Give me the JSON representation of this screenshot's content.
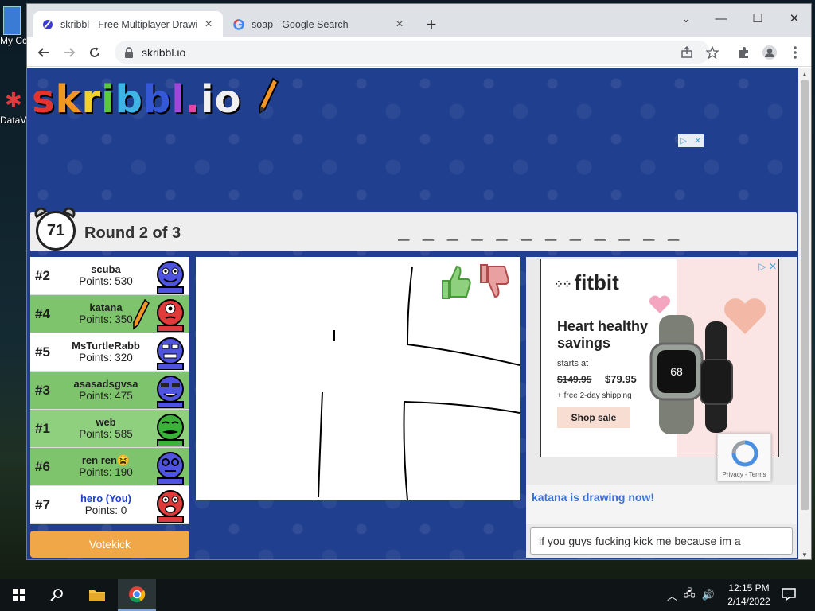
{
  "desktop": {
    "icons": [
      {
        "label": "My Co"
      },
      {
        "label": "DataV"
      }
    ]
  },
  "browser": {
    "tabs": [
      {
        "title": "skribbl - Free Multiplayer Drawin",
        "icon": "skribbl-favicon",
        "active": true
      },
      {
        "title": "soap - Google Search",
        "icon": "google-favicon",
        "active": false
      }
    ],
    "new_tab": "+",
    "window_controls": {
      "collapse": "⌄",
      "minimize": "—",
      "maximize": "☐",
      "close": "✕"
    },
    "url": "skribbl.io"
  },
  "game": {
    "logo_letters": [
      {
        "ch": "s",
        "color": "#e5342d"
      },
      {
        "ch": "k",
        "color": "#f29522"
      },
      {
        "ch": "r",
        "color": "#f1d12c"
      },
      {
        "ch": "i",
        "color": "#5bc93f"
      },
      {
        "ch": "b",
        "color": "#3fb2e6"
      },
      {
        "ch": "b",
        "color": "#3558d6"
      },
      {
        "ch": "l",
        "color": "#a146d6"
      },
      {
        "ch": ".",
        "color": "#e347a3"
      },
      {
        "ch": "i",
        "color": "#f0f0f0"
      },
      {
        "ch": "o",
        "color": "#f0f0f0"
      }
    ],
    "timer": "71",
    "round": "Round 2 of 3",
    "word_hint": "_ _ _ _ _ _ _ _ _ _ _ _",
    "players": [
      {
        "rank": "#2",
        "name": "scuba",
        "points": "Points: 530",
        "guessed": false,
        "you": false,
        "drawing": false,
        "avatar_color": "#4f54e0"
      },
      {
        "rank": "#4",
        "name": "katana",
        "points": "Points: 350",
        "guessed": true,
        "you": false,
        "drawing": true,
        "avatar_color": "#e03a3a"
      },
      {
        "rank": "#5",
        "name": "MsTurtleRabb",
        "points": "Points: 320",
        "guessed": false,
        "you": false,
        "drawing": false,
        "avatar_color": "#4f54e0"
      },
      {
        "rank": "#3",
        "name": "asasadsgvsa",
        "points": "Points: 475",
        "guessed": true,
        "you": false,
        "drawing": false,
        "avatar_color": "#4f54e0"
      },
      {
        "rank": "#1",
        "name": "web",
        "points": "Points: 585",
        "guessed": true,
        "you": false,
        "drawing": false,
        "avatar_color": "#3bb33b"
      },
      {
        "rank": "#6",
        "name": "ren ren😫",
        "points": "Points: 190",
        "guessed": true,
        "you": false,
        "drawing": false,
        "avatar_color": "#4f54e0"
      },
      {
        "rank": "#7",
        "name": "hero (You)",
        "points": "Points: 0",
        "guessed": false,
        "you": true,
        "drawing": false,
        "avatar_color": "#e03a3a"
      }
    ],
    "votekick": "Votekick",
    "chat": {
      "system_message": "katana is drawing now!",
      "input_value": "if you guys fucking kick me because im a"
    }
  },
  "ad": {
    "brand": "fitbit",
    "headline": "Heart healthy savings",
    "starts_at": "starts at",
    "old_price": "$149.95",
    "new_price": "$79.95",
    "shipping": "+ free 2-day shipping",
    "cta": "Shop sale",
    "watch_time": "68"
  },
  "recaptcha": {
    "links": "Privacy - Terms"
  },
  "taskbar": {
    "time": "12:15 PM",
    "date": "2/14/2022"
  },
  "colors": {
    "accent_blue": "#213f8f",
    "guessed_green": "#8fd07e",
    "votekick_orange": "#f0a747"
  }
}
